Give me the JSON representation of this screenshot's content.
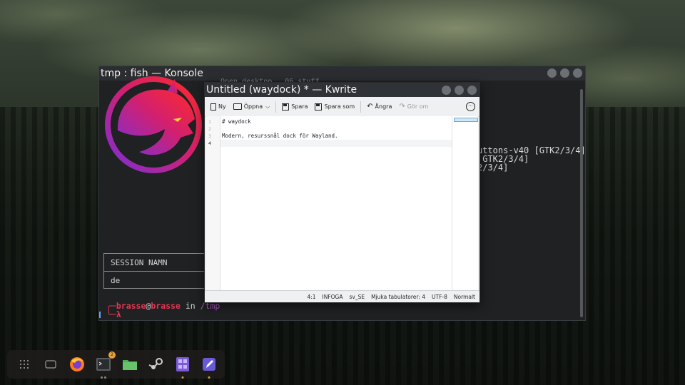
{
  "konsole": {
    "title": "tmp : fish — Konsole",
    "background_text": "Open desktop … 06 stuff",
    "right_lines": [
      "uttons-v40 [GTK2/3/4]",
      " GTK2/3/4]",
      "2/3/4]"
    ],
    "session_header": "SESSION NAMN",
    "session_value": "de",
    "prompt": {
      "user": "brasse",
      "at": "@",
      "host": "brasse",
      "in": " in ",
      "path": "/tmp",
      "symbol": "λ"
    }
  },
  "kwrite": {
    "title": "Untitled (waydock) * — Kwrite",
    "toolbar": {
      "new": "Ny",
      "open": "Öppna",
      "save": "Spara",
      "save_as": "Spara som",
      "undo": "Ångra",
      "redo": "Gör om"
    },
    "lines": [
      {
        "num": "1",
        "text": "# waydock"
      },
      {
        "num": "2",
        "text": ""
      },
      {
        "num": "3",
        "text": "Modern, resurssnål dock för Wayland."
      },
      {
        "num": "4",
        "text": ""
      }
    ],
    "status": {
      "position": "4:1",
      "mode": "INFOGA",
      "language": "sv_SE",
      "indent": "Mjuka tabulatorer: 4",
      "encoding": "UTF-8",
      "syntax": "Normalt"
    }
  },
  "dock": {
    "items": [
      "app-grid-icon",
      "show-desktop-icon",
      "firefox-icon",
      "terminal-icon",
      "files-icon",
      "steam-icon",
      "calculator-icon",
      "kwrite-icon"
    ],
    "terminal_badge": "2"
  }
}
